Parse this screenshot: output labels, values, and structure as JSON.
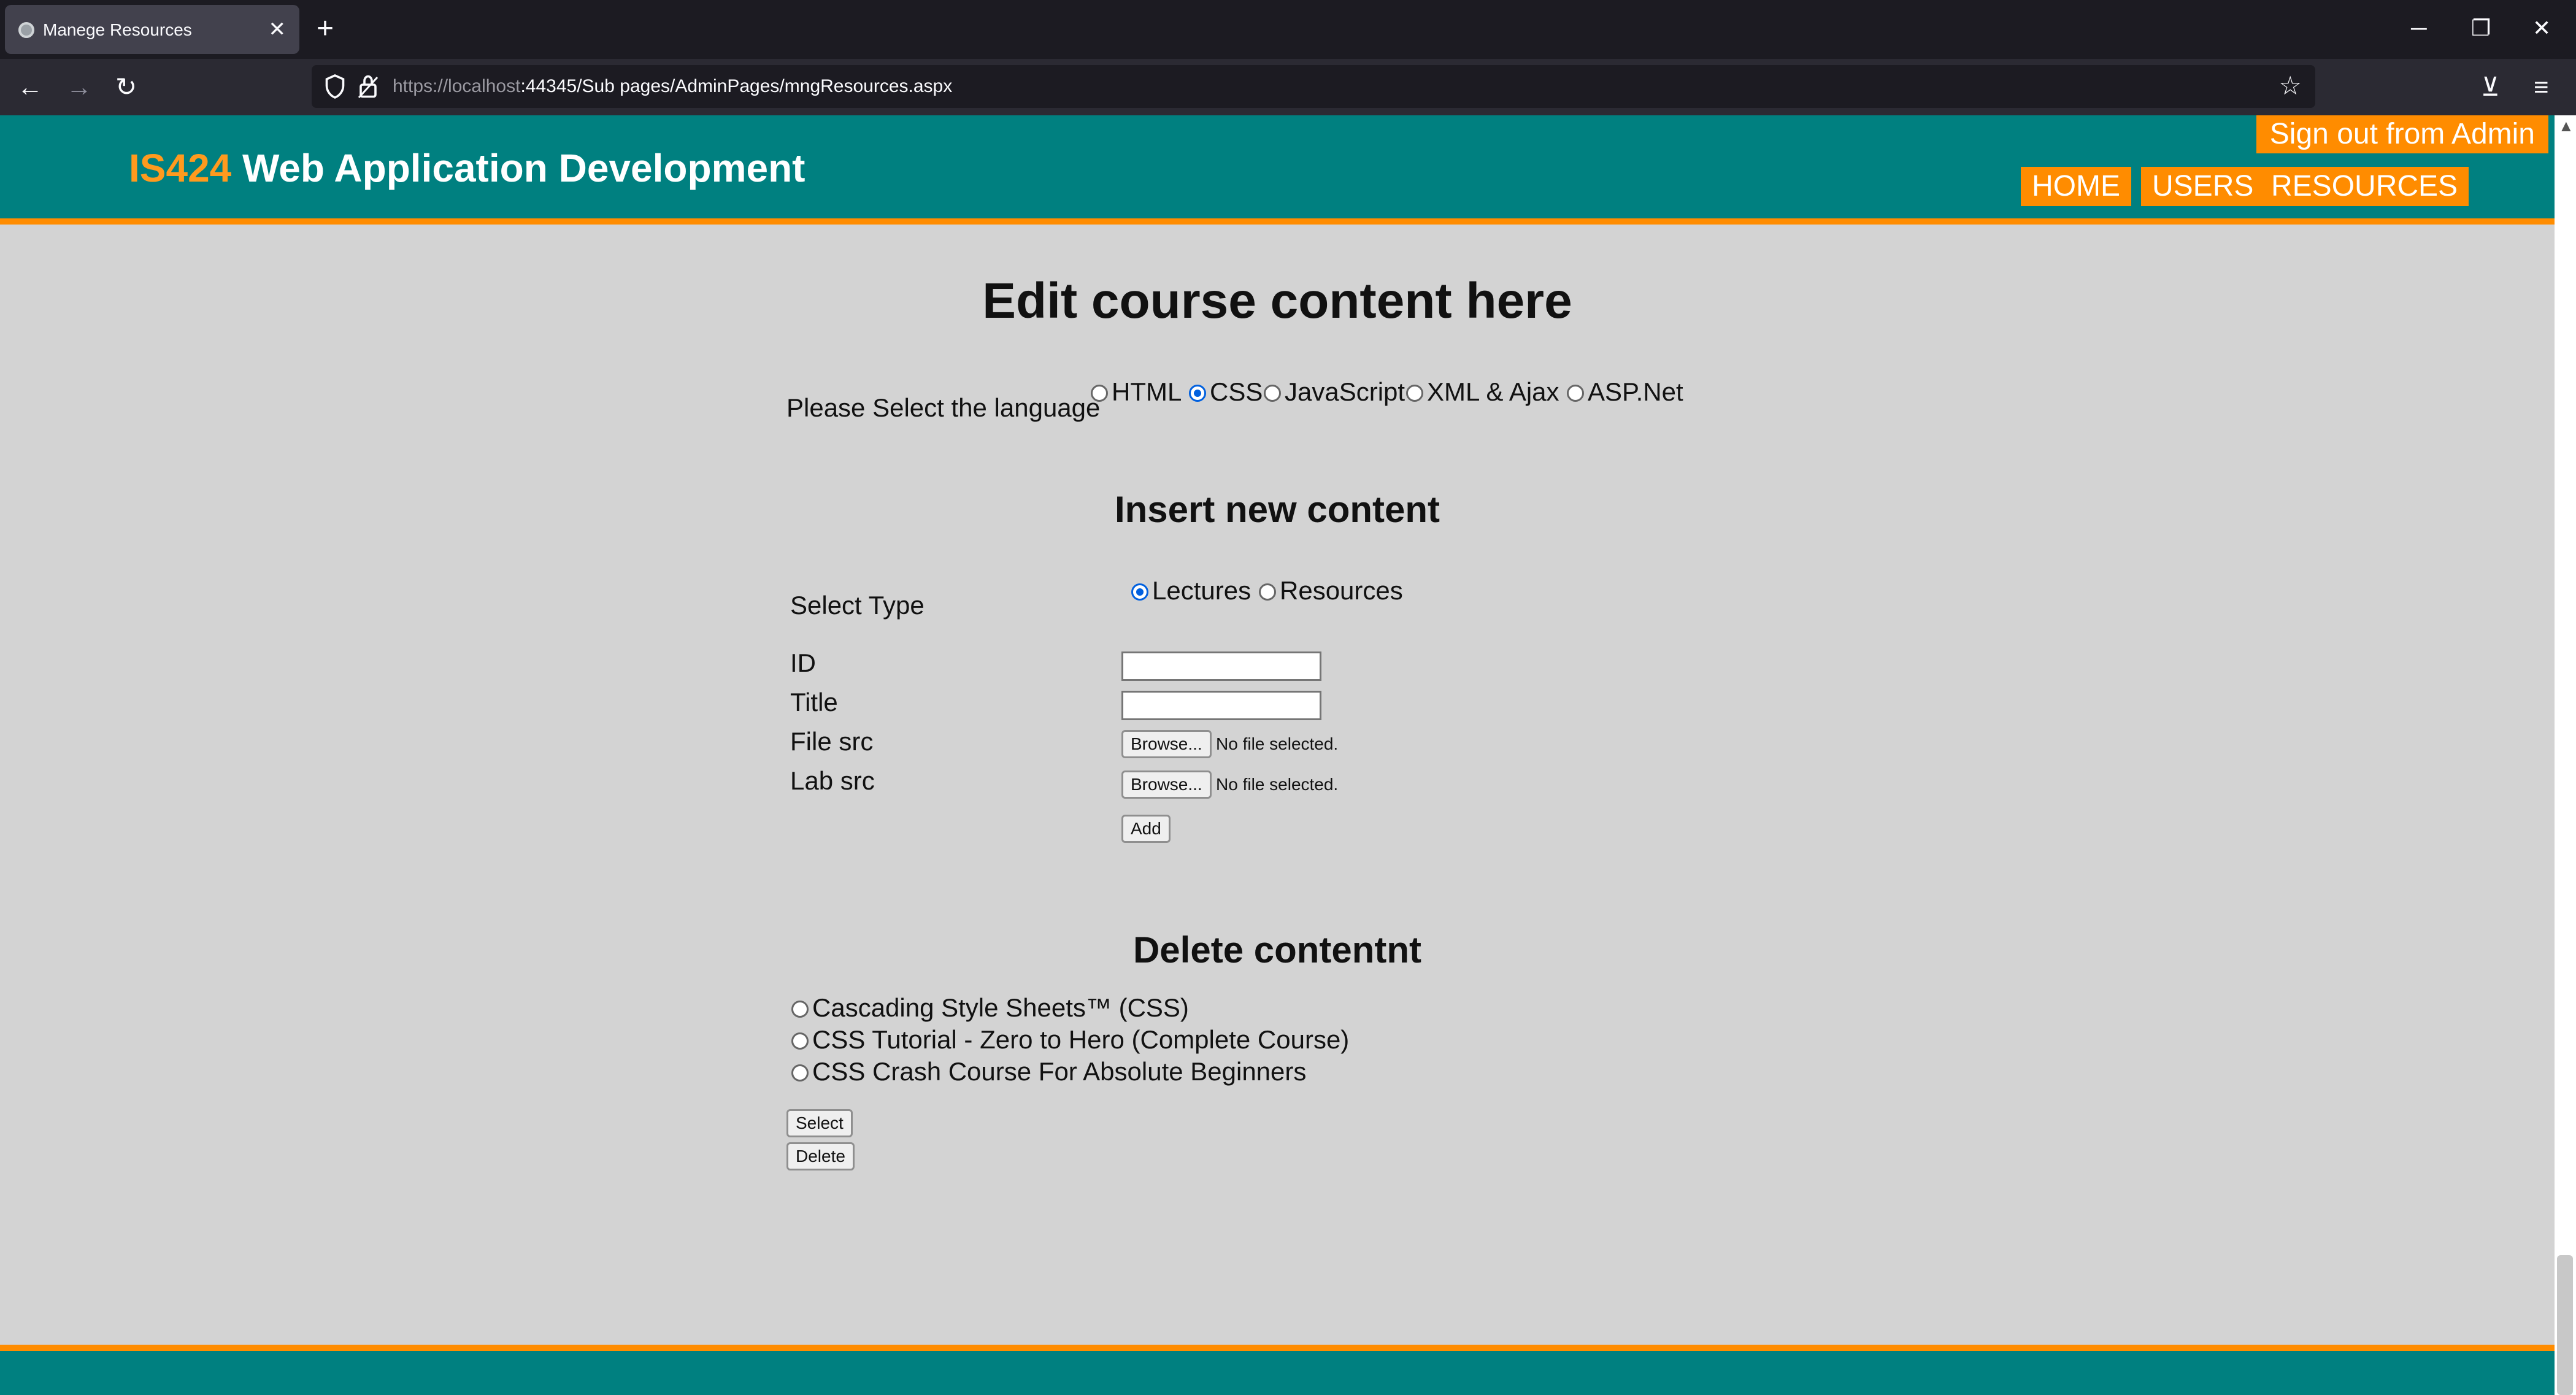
{
  "browser": {
    "tab_title": "Manege Resources",
    "tab_close": "✕",
    "new_tab": "+",
    "url_host": "https://localhost",
    "url_port_path": ":44345/Sub pages/AdminPages/mngResources.aspx",
    "back": "←",
    "forward": "→",
    "reload": "↻",
    "star": "☆",
    "pocket": "⊻",
    "menu": "≡",
    "minimize": "─",
    "restore": "❐",
    "close": "✕"
  },
  "header": {
    "brand_code": "IS424",
    "brand_title": "Web Application Development",
    "sign_out": "Sign out from Admin",
    "nav": [
      "HOME",
      "USERS",
      "RESOURCES"
    ],
    "accent_color": "#ff8c00",
    "header_color": "#008080"
  },
  "main": {
    "title": "Edit course content here",
    "language_label": "Please Select the language",
    "languages": [
      {
        "label": "HTML",
        "selected": false
      },
      {
        "label": "CSS",
        "selected": true
      },
      {
        "label": "JavaScript",
        "selected": false
      },
      {
        "label": "XML & Ajax",
        "selected": false
      },
      {
        "label": "ASP.Net",
        "selected": false
      }
    ],
    "insert": {
      "heading": "Insert new content",
      "type_label": "Select Type",
      "types": [
        {
          "label": "Lectures",
          "selected": true
        },
        {
          "label": "Resources",
          "selected": false
        }
      ],
      "id_label": "ID",
      "id_value": "",
      "title_label": "Title",
      "title_value": "",
      "file_label": "File src",
      "lab_label": "Lab src",
      "browse_label": "Browse...",
      "no_file": "No file selected.",
      "add_label": "Add"
    },
    "delete": {
      "heading": "Delete contentnt",
      "items": [
        "Cascading Style Sheets™ (CSS)",
        "CSS Tutorial - Zero to Hero (Complete Course)",
        "CSS Crash Course For Absolute Beginners"
      ],
      "select_label": "Select",
      "delete_label": "Delete"
    }
  }
}
